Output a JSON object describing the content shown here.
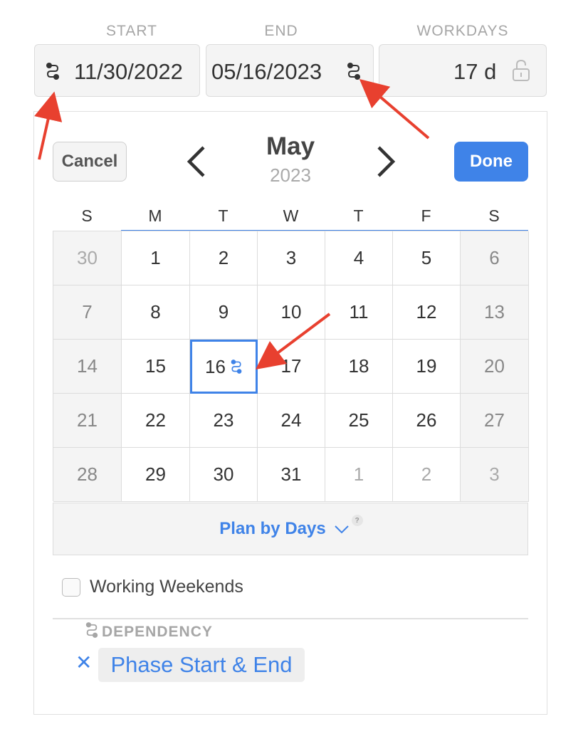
{
  "fields": {
    "start_label": "START",
    "end_label": "END",
    "workdays_label": "WORKDAYS",
    "start_value": "11/30/2022",
    "end_value": "05/16/2023",
    "workdays_value": "17 d"
  },
  "calendar": {
    "cancel_label": "Cancel",
    "done_label": "Done",
    "month": "May",
    "year": "2023",
    "weekdays": [
      "S",
      "M",
      "T",
      "W",
      "T",
      "F",
      "S"
    ],
    "weeks": [
      [
        "30",
        "1",
        "2",
        "3",
        "4",
        "5",
        "6"
      ],
      [
        "7",
        "8",
        "9",
        "10",
        "11",
        "12",
        "13"
      ],
      [
        "14",
        "15",
        "16",
        "17",
        "18",
        "19",
        "20"
      ],
      [
        "21",
        "22",
        "23",
        "24",
        "25",
        "26",
        "27"
      ],
      [
        "28",
        "29",
        "30",
        "31",
        "1",
        "2",
        "3"
      ]
    ],
    "selected_day": "16"
  },
  "plan": {
    "label": "Plan by Days",
    "help": "?"
  },
  "options": {
    "working_weekends_label": "Working Weekends",
    "working_weekends_checked": false
  },
  "dependency": {
    "header": "DEPENDENCY",
    "remove": "✕",
    "chip_label": "Phase Start & End"
  },
  "colors": {
    "accent": "#3f83e8",
    "arrow": "#e8402f",
    "weekend_bg": "#f4f4f4"
  },
  "icons": {
    "dependency": "dependency-icon",
    "lock": "unlock-icon",
    "prev": "chevron-left-icon",
    "next": "chevron-right-icon",
    "chevron": "chevron-down-icon"
  }
}
